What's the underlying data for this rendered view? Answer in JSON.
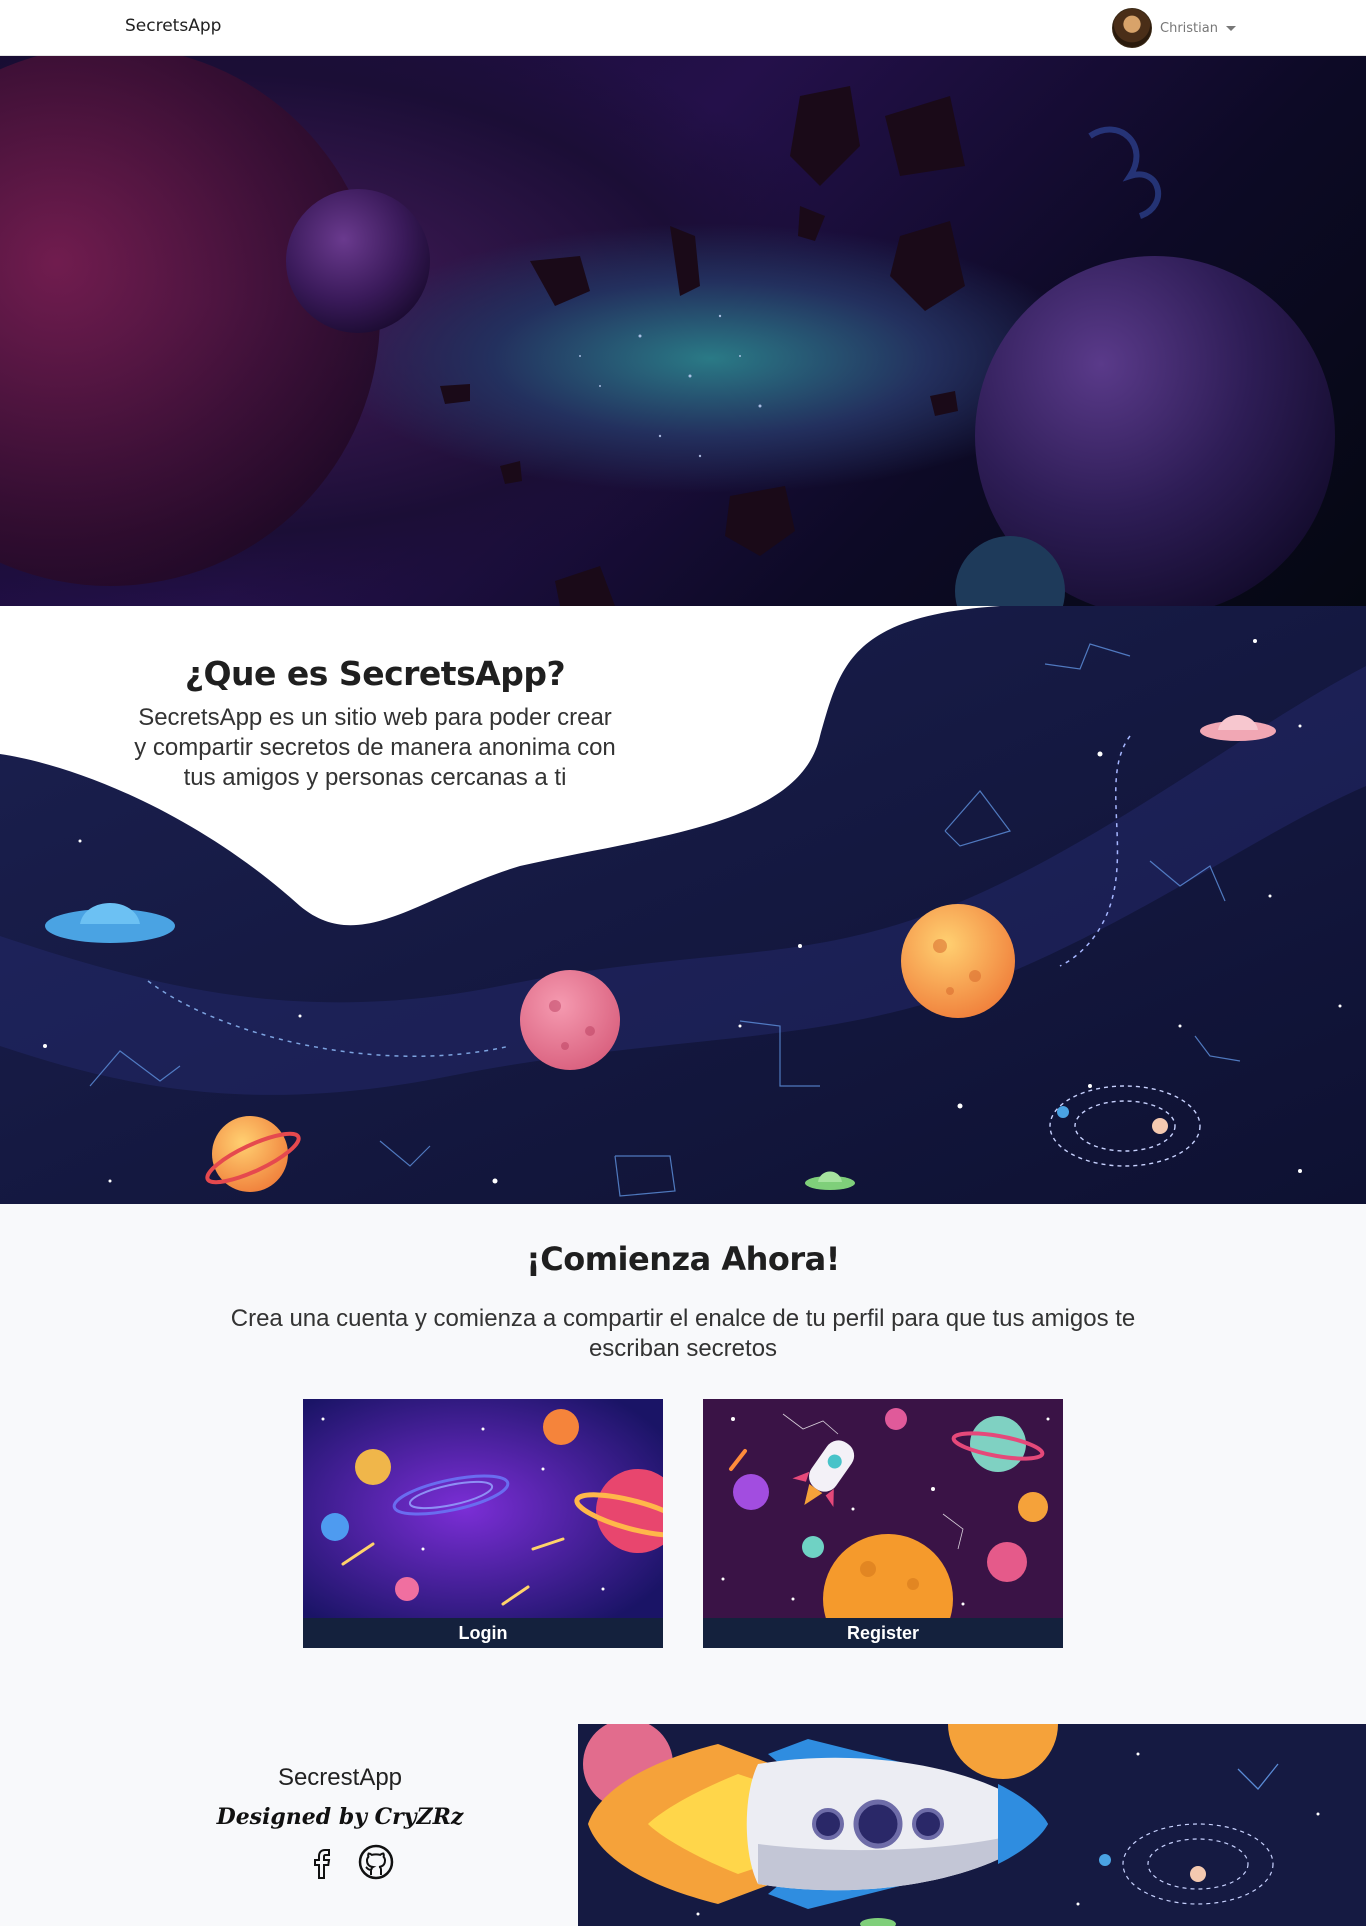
{
  "navbar": {
    "brand": "SecretsApp",
    "user": {
      "name": "Christian",
      "avatar_icon": "avatar-portrait-icon",
      "menu_icon": "caret-down-icon"
    }
  },
  "about": {
    "title": "¿Que es SecretsApp?",
    "description": "SecretsApp es un sitio web para poder crear y compartir secretos de manera anonima con tus amigos y personas cercanas a ti"
  },
  "start": {
    "title": "¡Comienza Ahora!",
    "description": "Crea una cuenta y comienza a compartir el enalce de tu perfil para que tus amigos te escriban secretos",
    "cards": [
      {
        "label": "Login"
      },
      {
        "label": "Register"
      }
    ]
  },
  "footer": {
    "brand": "SecrestApp",
    "credit": "Designed by CryZRz",
    "social": [
      "facebook-icon",
      "github-icon"
    ]
  },
  "colors": {
    "navbar_bg": "#ffffff",
    "space_dark": "#151a42",
    "card_label_bg": "#14213d",
    "page_bg": "#f8f9fb"
  }
}
